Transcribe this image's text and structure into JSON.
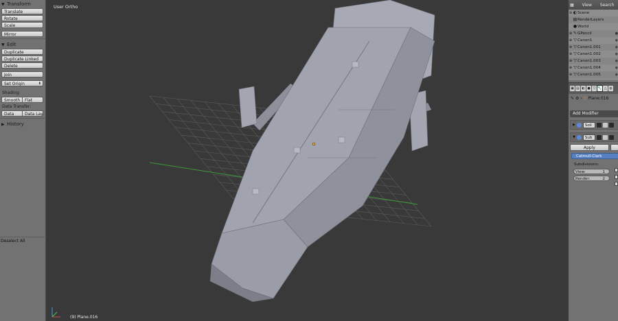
{
  "toolshelf": {
    "transform_header": "Transform",
    "transform_buttons": [
      "Translate",
      "Rotate",
      "Scale"
    ],
    "mirror": "Mirror",
    "edit_header": "Edit",
    "edit_buttons": [
      "Duplicate",
      "Duplicate Linked",
      "Delete"
    ],
    "join": "Join",
    "set_origin": "Set Origin",
    "shading_label": "Shading:",
    "smooth": "Smooth",
    "flat": "Flat",
    "data_transfer_label": "Data Transfer:",
    "data": "Data",
    "data_layout": "Data Layo",
    "history_header": "History",
    "last_operator": "Deselect All"
  },
  "viewport": {
    "view_label": "User Ortho",
    "object_label": "(9) Plane.016"
  },
  "outliner": {
    "menu": [
      "View",
      "Search"
    ],
    "rows": [
      {
        "label": "Scene",
        "icon": "scene-icon",
        "glyph": "◐"
      },
      {
        "label": "RenderLayers",
        "icon": "render-layers-icon",
        "glyph": "▤"
      },
      {
        "label": "World",
        "icon": "world-icon",
        "glyph": "●"
      },
      {
        "label": "GPencil",
        "icon": "grease-pencil-icon",
        "glyph": "✎"
      },
      {
        "label": "Canon1",
        "icon": "object-icon",
        "glyph": "▽"
      },
      {
        "label": "Canon1.001",
        "icon": "object-icon",
        "glyph": "▽"
      },
      {
        "label": "Canon1.002",
        "icon": "object-icon",
        "glyph": "▽"
      },
      {
        "label": "Canon1.003",
        "icon": "object-icon",
        "glyph": "▽"
      },
      {
        "label": "Canon1.004",
        "icon": "object-icon",
        "glyph": "▽"
      },
      {
        "label": "Canon1.005",
        "icon": "object-icon",
        "glyph": "▽"
      }
    ]
  },
  "properties": {
    "object_name": "Plane.016",
    "add_modifier": "Add Modifier",
    "modifiers": [
      {
        "name": "Soli"
      },
      {
        "name": "Sub"
      }
    ],
    "apply": "Apply",
    "subsurf_type": "Catmull-Clark",
    "subdivisions_label": "Subdivisions:",
    "view_label": "View:",
    "view_value": "1",
    "render_label": "Render:",
    "render_value": "2"
  },
  "colors": {
    "grid": "#5c5c5c",
    "x_axis": "#8b3f3f",
    "y_axis": "#3c9a3c",
    "ship": "#9c9eaa",
    "accent": "#5680c2"
  }
}
